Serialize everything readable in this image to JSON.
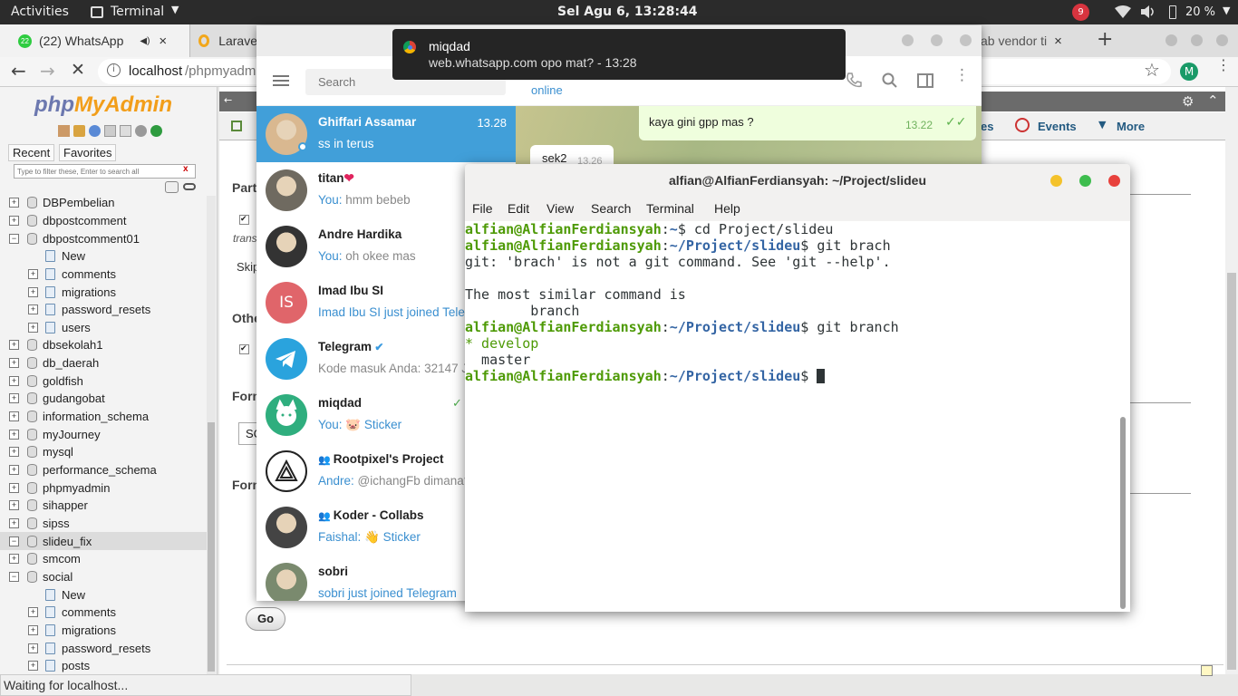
{
  "topbar": {
    "activities": "Activities",
    "app": "Terminal",
    "clock": "Sel Agu  6, 13:28:44",
    "badge": "9",
    "battery": "20 %"
  },
  "browser": {
    "tabs": [
      {
        "label": "(22) WhatsApp",
        "badge": "22"
      },
      {
        "label": "Larave"
      },
      {
        "label": "ab vendor ti"
      }
    ],
    "url": {
      "host": "localhost",
      "path": "/phpmyadmi"
    },
    "profile": "M",
    "status": "Waiting for localhost..."
  },
  "notification": {
    "title": "miqdad",
    "body": "web.whatsapp.com  opo mat? - 13:28"
  },
  "pma": {
    "logo_php": "php",
    "logo_my": "MyAdmin",
    "recent": "Recent",
    "favorites": "Favorites",
    "filter_placeholder": "Type to filter these, Enter to search all",
    "filter_clear": "x",
    "tree": [
      {
        "label": "DBPembelian",
        "sign": "+",
        "sub": false
      },
      {
        "label": "dbpostcomment",
        "sign": "+",
        "sub": false
      },
      {
        "label": "dbpostcomment01",
        "sign": "−",
        "sub": false
      },
      {
        "label": "New",
        "sign": "",
        "sub": true
      },
      {
        "label": "comments",
        "sign": "+",
        "sub": true
      },
      {
        "label": "migrations",
        "sign": "+",
        "sub": true
      },
      {
        "label": "password_resets",
        "sign": "+",
        "sub": true
      },
      {
        "label": "users",
        "sign": "+",
        "sub": true
      },
      {
        "label": "dbsekolah1",
        "sign": "+",
        "sub": false
      },
      {
        "label": "db_daerah",
        "sign": "+",
        "sub": false
      },
      {
        "label": "goldfish",
        "sign": "+",
        "sub": false
      },
      {
        "label": "gudangobat",
        "sign": "+",
        "sub": false
      },
      {
        "label": "information_schema",
        "sign": "+",
        "sub": false
      },
      {
        "label": "myJourney",
        "sign": "+",
        "sub": false
      },
      {
        "label": "mysql",
        "sign": "+",
        "sub": false
      },
      {
        "label": "performance_schema",
        "sign": "+",
        "sub": false
      },
      {
        "label": "phpmyadmin",
        "sign": "+",
        "sub": false
      },
      {
        "label": "sihapper",
        "sign": "+",
        "sub": false
      },
      {
        "label": "sipss",
        "sign": "+",
        "sub": false
      },
      {
        "label": "slideu_fix",
        "sign": "−",
        "sub": false
      },
      {
        "label": "smcom",
        "sign": "+",
        "sub": false
      },
      {
        "label": "social",
        "sign": "−",
        "sub": false
      },
      {
        "label": "New",
        "sign": "",
        "sub": true
      },
      {
        "label": "comments",
        "sign": "+",
        "sub": true
      },
      {
        "label": "migrations",
        "sign": "+",
        "sub": true
      },
      {
        "label": "password_resets",
        "sign": "+",
        "sub": true
      },
      {
        "label": "posts",
        "sign": "+",
        "sub": true
      }
    ],
    "main": {
      "tab_events": "Events",
      "tab_more": "More",
      "tab_partial": "es",
      "part": "Part",
      "trans": "trans",
      "skip": "Skip",
      "other": "Othe",
      "form1": "Form",
      "form2": "Form",
      "select_partial": "SC",
      "go": "Go"
    }
  },
  "telegram": {
    "search_placeholder": "Search",
    "status": "online",
    "msg1": {
      "text": "kaya gini gpp mas ?",
      "time": "13.22"
    },
    "msg2": {
      "text": "sek2",
      "time": "13.26"
    },
    "chats": [
      {
        "name": "Ghiffari Assamar",
        "time": "13.28",
        "you": "",
        "preview": "ss in terus",
        "avatar": "photo",
        "color": "#d9b890"
      },
      {
        "name": "titan",
        "time": "",
        "you": "You: ",
        "preview": "hmm bebeb",
        "avatar": "photo",
        "color": "#6f6a60",
        "heart": "❤"
      },
      {
        "name": "Andre Hardika",
        "time": "",
        "you": "You: ",
        "preview": "oh okee mas",
        "avatar": "photo",
        "color": "#333"
      },
      {
        "name": "Imad Ibu SI",
        "time": "",
        "you": "",
        "preview": "Imad Ibu SI just joined Tele",
        "avatar": "IS",
        "color": "#e0656a"
      },
      {
        "name": "Telegram",
        "time": "",
        "you": "",
        "preview": "Kode masuk Anda: 32147 J",
        "avatar": "tg",
        "color": "#2aa3dd"
      },
      {
        "name": "miqdad",
        "time": "",
        "you": "You: ",
        "preview": "🐷 Sticker",
        "avatar": "dog",
        "color": "#2fae7e"
      },
      {
        "name": "Rootpixel's Project",
        "time": "",
        "you": "Andre: ",
        "preview": "@ichangFb dimana?",
        "avatar": "logo",
        "color": "#fff"
      },
      {
        "name": "Koder - Collabs",
        "time": "",
        "you": "Faishal: ",
        "preview": "👋 Sticker",
        "avatar": "photo",
        "color": "#444"
      },
      {
        "name": "sobri",
        "time": "",
        "you": "",
        "preview": "sobri just joined Telegram",
        "avatar": "photo",
        "color": "#7a8a6e"
      }
    ]
  },
  "terminal": {
    "title": "alfian@AlfianFerdiansyah: ~/Project/slideu",
    "menu": [
      "File",
      "Edit",
      "View",
      "Search",
      "Terminal",
      "Help"
    ],
    "prompt_user": "alfian@AlfianFerdiansyah",
    "lines": [
      {
        "dir": "~",
        "cmd": "cd Project/slideu"
      },
      {
        "dir": "~/Project/slideu",
        "cmd": "git brach"
      },
      {
        "out": "git: 'brach' is not a git command. See 'git --help'."
      },
      {
        "out": ""
      },
      {
        "out": "The most similar command is"
      },
      {
        "out": "        branch"
      },
      {
        "dir": "~/Project/slideu",
        "cmd": "git branch"
      },
      {
        "out": "* develop",
        "green": true
      },
      {
        "out": "  master"
      },
      {
        "dir": "~/Project/slideu",
        "cmd": "",
        "cursor": true
      }
    ]
  }
}
